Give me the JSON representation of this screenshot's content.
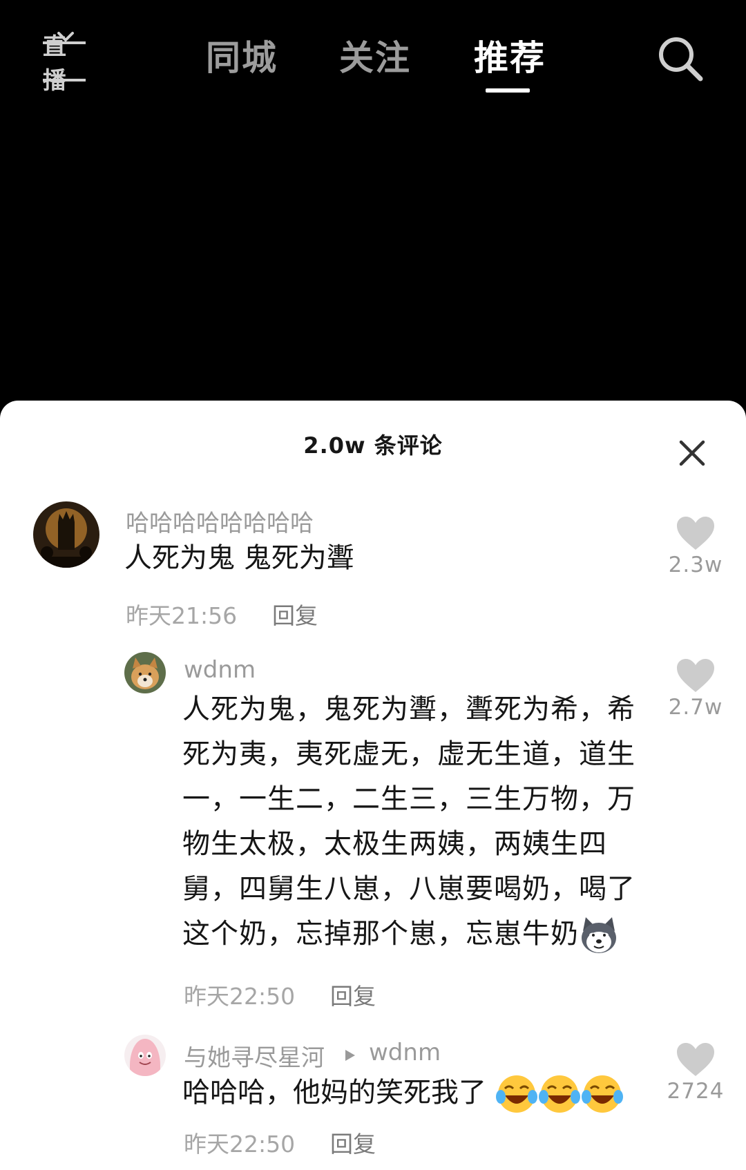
{
  "nav": {
    "live_label": "直播",
    "tabs": [
      {
        "label": "同城",
        "active": false
      },
      {
        "label": "关注",
        "active": false
      },
      {
        "label": "推荐",
        "active": true
      }
    ]
  },
  "comments_panel": {
    "title": "2.0w 条评论",
    "comments": [
      {
        "user": "哈哈哈哈哈哈哈哈",
        "text": "人死为鬼 鬼死为聻",
        "time": "昨天21:56",
        "reply_label": "回复",
        "likes": "2.3w"
      },
      {
        "user": "wdnm",
        "text": "人死为鬼，鬼死为聻，聻死为希，希死为夷，夷死虚无，虚无生道，道生一，一生二，二生三，三生万物，万物生太极，太极生两姨，两姨生四舅，四舅生八崽，八崽要喝奶，喝了这个奶，忘掉那个崽，忘崽牛奶",
        "time": "昨天22:50",
        "reply_label": "回复",
        "likes": "2.7w"
      },
      {
        "user": "与她寻尽星河",
        "reply_to": "wdnm",
        "text": "哈哈哈，他妈的笑死我了",
        "time": "昨天22:50",
        "reply_label": "回复",
        "likes": "2724"
      }
    ]
  },
  "icons": {
    "search": "search-icon",
    "close": "close-icon",
    "like": "heart-icon",
    "reply_arrow": "play-triangle-icon",
    "emoji_dog": "husky-emoji",
    "emoji_laugh": "crying-laugh-emoji"
  },
  "colors": {
    "background": "#000000",
    "sheet": "#ffffff",
    "tab_inactive": "#9c9c9c",
    "tab_active": "#ffffff",
    "muted_text": "#9a9a9a",
    "heart": "#cccccc"
  }
}
